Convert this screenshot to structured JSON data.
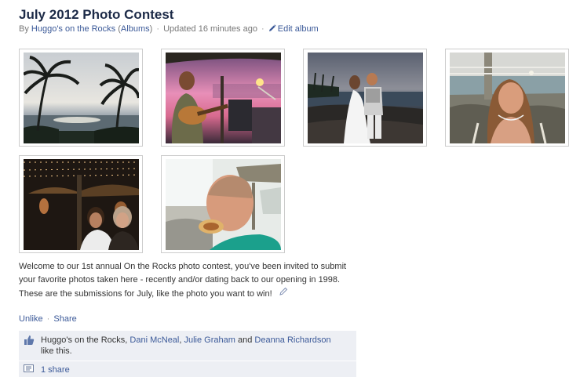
{
  "album": {
    "title": "July 2012 Photo Contest",
    "by_prefix": "By",
    "owner": "Huggo's on the Rocks",
    "albums_open": "(",
    "albums_link": "Albums",
    "albums_close": ")",
    "separator": "·",
    "updated": "Updated 16 minutes ago",
    "edit_label": "Edit album"
  },
  "photos": [
    {
      "alt": "Palm trees at sunset over the ocean"
    },
    {
      "alt": "Guitarist performing at dusk"
    },
    {
      "alt": "Wedding couple on the lava rocks"
    },
    {
      "alt": "Woman smiling by the shoreline"
    },
    {
      "alt": "Two women at night under the lights"
    },
    {
      "alt": "Man eating a burger"
    }
  ],
  "description": {
    "text": "Welcome to our 1st annual On the Rocks photo contest, you've been invited to submit your favorite photos taken here - recently and/or dating back to our opening in 1998. These are the submissions for July, like the photo you want to win!"
  },
  "actions": {
    "unlike": "Unlike",
    "separator": "·",
    "share": "Share"
  },
  "likes": {
    "first": "Huggo's on the Rocks",
    "comma1": ", ",
    "person1": "Dani McNeal",
    "comma2": ", ",
    "person2": "Julie Graham",
    "and": " and ",
    "person3": "Deanna Richardson",
    "suffix": "like this."
  },
  "shares": {
    "label": "1 share"
  },
  "colors": {
    "link": "#3b5998",
    "title": "#1c2a47",
    "ufi_background": "#edeff4"
  }
}
